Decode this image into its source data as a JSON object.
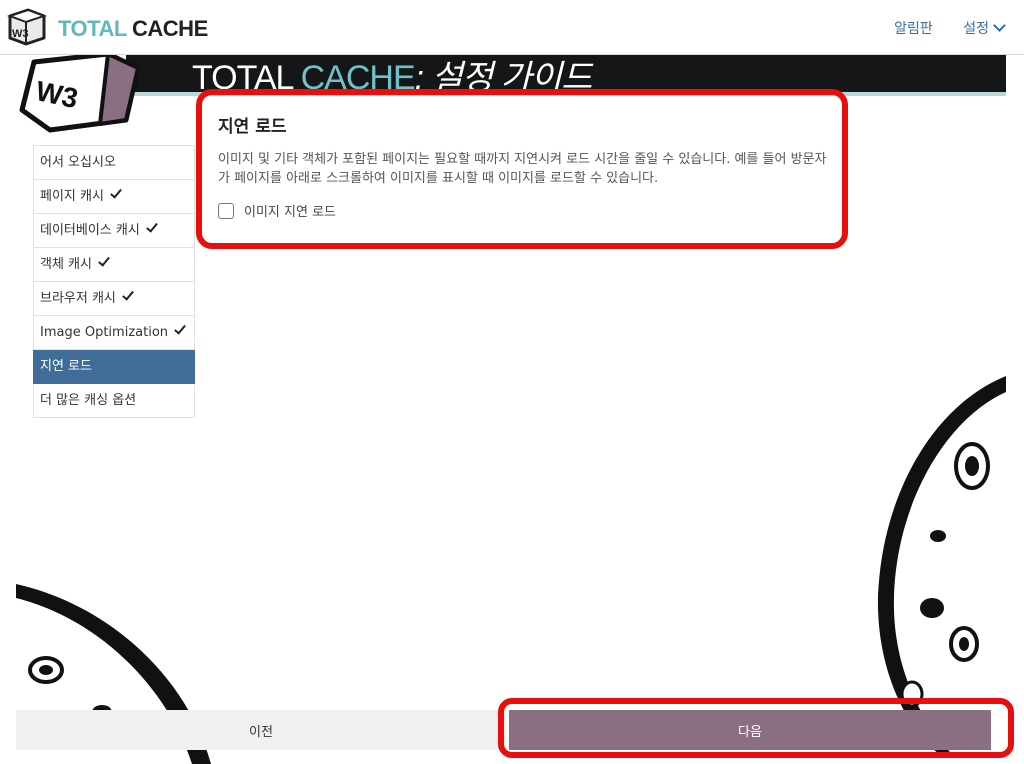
{
  "header": {
    "brand_w3": "W3",
    "brand_total": "TOTAL",
    "brand_cache": "CACHE",
    "nav": [
      {
        "label": "알림판"
      },
      {
        "label": "설정"
      }
    ]
  },
  "banner": {
    "title_total": "TOTAL",
    "title_cache": "CACHE",
    "title_rest": ": 설정 가이드",
    "cube_label": "W3"
  },
  "sidebar": {
    "steps": [
      {
        "label": "어서 오십시오",
        "checked": false
      },
      {
        "label": "페이지 캐시",
        "checked": true
      },
      {
        "label": "데이터베이스 캐시",
        "checked": true
      },
      {
        "label": "객체 캐시",
        "checked": true
      },
      {
        "label": "브라우저 캐시",
        "checked": true
      },
      {
        "label": "Image Optimization",
        "checked": true
      },
      {
        "label": "지연 로드",
        "checked": false,
        "active": true
      },
      {
        "label": "더 많은 캐싱 옵션",
        "checked": false
      }
    ]
  },
  "card": {
    "title": "지연 로드",
    "description": "이미지 및 기타 객체가 포함된 페이지는 필요할 때까지 지연시켜 로드 시간을 줄일 수 있습니다. 예를 들어 방문자가 페이지를 아래로 스크롤하여 이미지를 표시할 때 이미지를 로드할 수 있습니다.",
    "checkbox_label": "이미지 지연 로드",
    "checkbox_checked": false
  },
  "footer": {
    "prev_label": "이전",
    "next_label": "다음"
  },
  "colors": {
    "accent_teal": "#5fb8be",
    "active_step": "#3f6d97",
    "next_button": "#8a6f82",
    "highlight": "#e80f0f"
  }
}
